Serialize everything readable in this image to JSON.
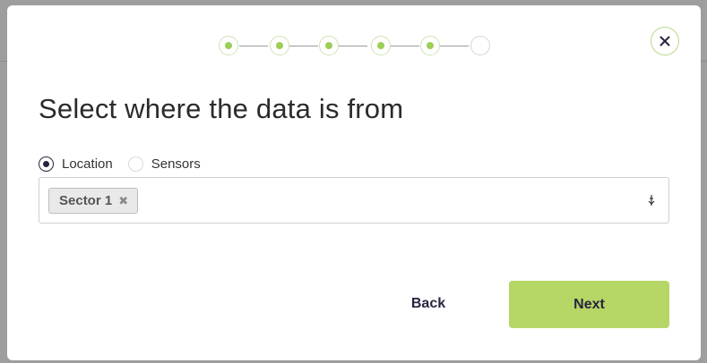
{
  "stepper": {
    "steps": [
      {
        "status": "done"
      },
      {
        "status": "done"
      },
      {
        "status": "done"
      },
      {
        "status": "done"
      },
      {
        "status": "done"
      },
      {
        "status": "pending"
      }
    ],
    "current_step": 6,
    "total_steps": 6,
    "accent_color": "#9bcf55"
  },
  "dialog": {
    "title": "Select where the data is from",
    "close_icon": "close-icon"
  },
  "source": {
    "options": [
      {
        "label": "Location",
        "checked": true
      },
      {
        "label": "Sensors",
        "checked": false
      }
    ]
  },
  "select": {
    "chips": [
      {
        "label": "Sector 1",
        "remove_glyph": "✖"
      }
    ],
    "arrow_icon": "dropdown-arrow-icon"
  },
  "footer": {
    "back_label": "Back",
    "next_label": "Next",
    "next_color": "#b6d665"
  }
}
